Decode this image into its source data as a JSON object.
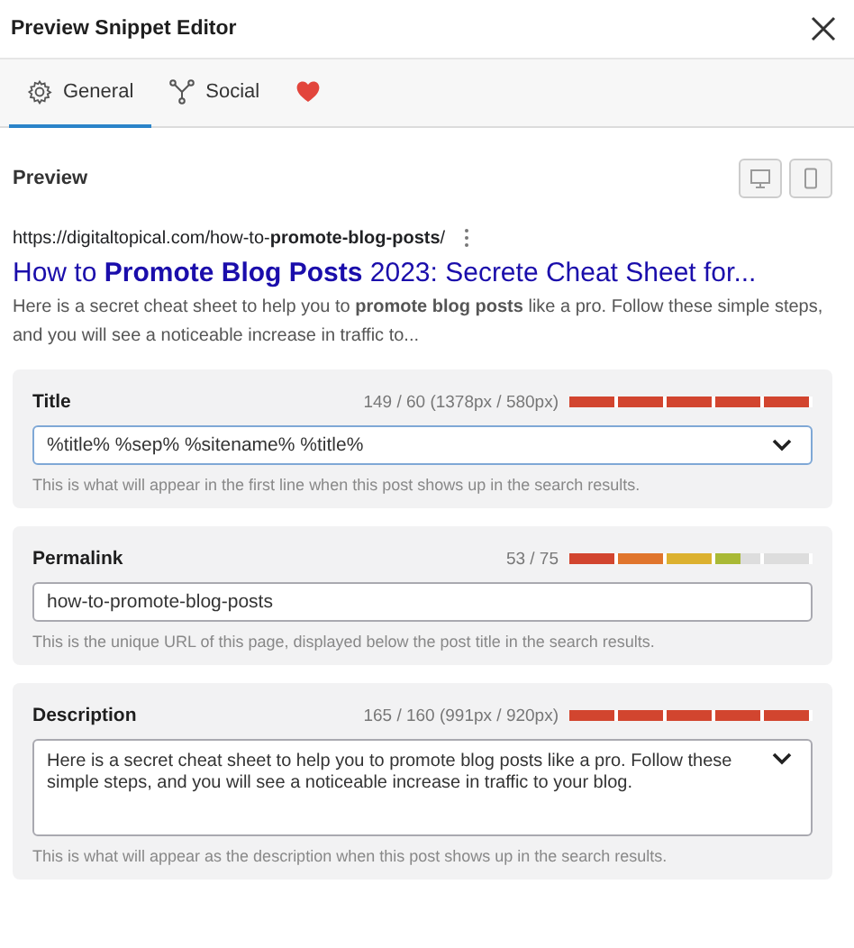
{
  "window": {
    "title": "Preview Snippet Editor"
  },
  "tabs": [
    {
      "kind": "gear",
      "label": "General",
      "selected": true
    },
    {
      "kind": "share",
      "label": "Social",
      "selected": false
    },
    {
      "kind": "heart",
      "selected": false
    }
  ],
  "preview": {
    "heading": "Preview",
    "devices": [
      {
        "kind": "desktop",
        "selected": false
      },
      {
        "kind": "mobile",
        "selected": false
      }
    ],
    "url": "https://digitaltopical.com/how-to-**promote-blog-posts**/",
    "title": "How to **Promote Blog Posts** 2023: Secrete Cheat Sheet for...",
    "description": "Here is a secret cheat sheet to help you to **promote blog posts** like a pro. Follow these simple steps, and you will see a noticeable increase in traffic to..."
  },
  "fields": [
    {
      "kind": "select",
      "label": "Title",
      "counter": "149 / 60 (1378px / 580px)",
      "level": 1,
      "over": true,
      "value": "%title% %sep% %sitename% %title%",
      "help": "This is what will appear in the first line when this post shows up in the search results."
    },
    {
      "kind": "text",
      "label": "Permalink",
      "counter": "53 / 75",
      "level": 0.7,
      "over": false,
      "value": "how-to-promote-blog-posts",
      "help": "This is the unique URL of this page, displayed below the post title in the search results."
    },
    {
      "kind": "textarea",
      "label": "Description",
      "counter": "165 / 160 (991px / 920px)",
      "level": 1,
      "over": true,
      "value": "Here is a secret cheat sheet to help you to promote blog posts like a pro. Follow these simple steps, and you will see a noticeable increase in traffic to your blog.",
      "help": "This is what will appear as the description when this post shows up in the search results."
    }
  ]
}
